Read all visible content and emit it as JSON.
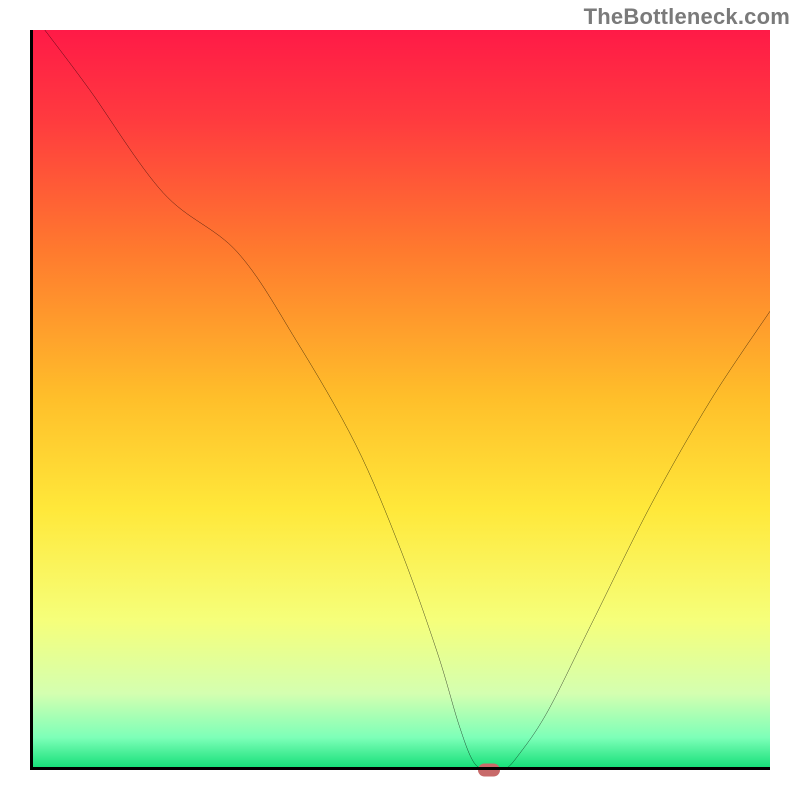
{
  "watermark": "TheBottleneck.com",
  "chart_data": {
    "type": "line",
    "title": "",
    "xlabel": "",
    "ylabel": "",
    "xlim": [
      0,
      100
    ],
    "ylim": [
      0,
      100
    ],
    "description": "Bottleneck curve over a red-to-green vertical gradient background. Y represents bottleneck severity (high = red = bad, low = green = good). The curve reaches its minimum (optimal point) around x ≈ 62.",
    "x": [
      2,
      8,
      18,
      28,
      36,
      44,
      50,
      55,
      58,
      60,
      62,
      64,
      66,
      70,
      76,
      84,
      92,
      100
    ],
    "values": [
      100,
      92,
      78,
      70,
      58,
      44,
      30,
      16,
      6,
      1,
      0,
      0,
      2,
      8,
      20,
      36,
      50,
      62
    ],
    "optimum": {
      "x": 62,
      "y": 0
    },
    "gradient_stops": [
      {
        "pct": 0,
        "color": "#ff1a47"
      },
      {
        "pct": 12,
        "color": "#ff3a3f"
      },
      {
        "pct": 30,
        "color": "#ff7a2e"
      },
      {
        "pct": 50,
        "color": "#ffbf2a"
      },
      {
        "pct": 65,
        "color": "#ffe83a"
      },
      {
        "pct": 80,
        "color": "#f6ff7a"
      },
      {
        "pct": 90,
        "color": "#d4ffb0"
      },
      {
        "pct": 96,
        "color": "#7dffb8"
      },
      {
        "pct": 100,
        "color": "#18e07a"
      }
    ]
  }
}
